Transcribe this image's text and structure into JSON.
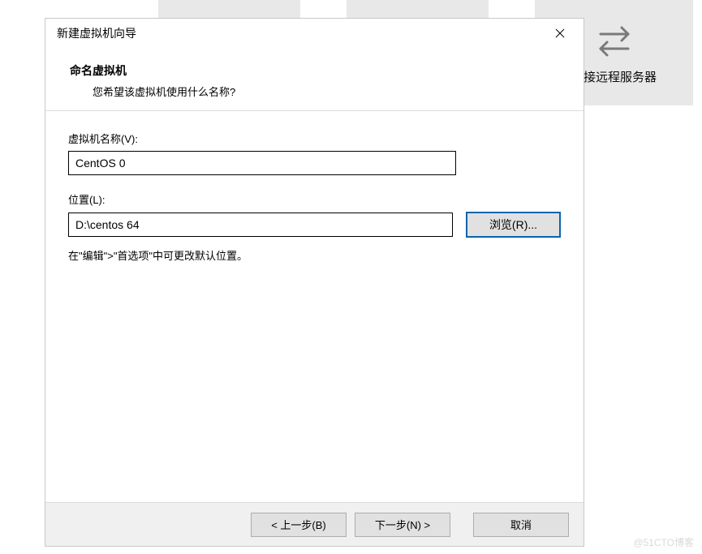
{
  "background": {
    "tile3_label": "连接远程服务器",
    "tile3_icon": "swap-arrows-icon"
  },
  "dialog": {
    "title": "新建虚拟机向导",
    "header": {
      "title": "命名虚拟机",
      "subtitle": "您希望该虚拟机使用什么名称?"
    },
    "fields": {
      "name_label": "虚拟机名称(V):",
      "name_value": "CentOS 0",
      "location_label": "位置(L):",
      "location_value": "D:\\centos 64",
      "browse_label": "浏览(R)...",
      "hint": "在\"编辑\">\"首选项\"中可更改默认位置。"
    },
    "footer": {
      "back": "< 上一步(B)",
      "next": "下一步(N) >",
      "cancel": "取消"
    }
  },
  "watermark": "@51CTO博客"
}
